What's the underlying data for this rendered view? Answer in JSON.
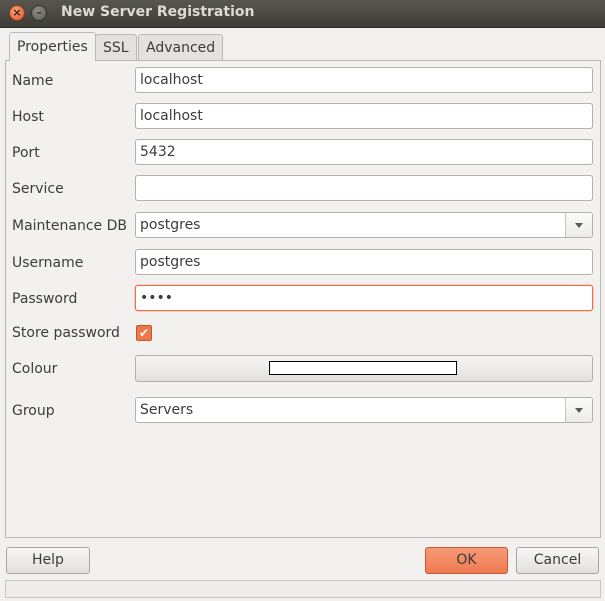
{
  "window": {
    "title": "New Server Registration",
    "close_glyph": "×",
    "minimize_glyph": "–"
  },
  "tabs": [
    {
      "label": "Properties"
    },
    {
      "label": "SSL"
    },
    {
      "label": "Advanced"
    }
  ],
  "form": {
    "name": {
      "label": "Name",
      "value": "localhost"
    },
    "host": {
      "label": "Host",
      "value": "localhost"
    },
    "port": {
      "label": "Port",
      "value": "5432"
    },
    "service": {
      "label": "Service",
      "value": ""
    },
    "maintenance_db": {
      "label": "Maintenance DB",
      "value": "postgres"
    },
    "username": {
      "label": "Username",
      "value": "postgres"
    },
    "password": {
      "label": "Password",
      "value": "••••"
    },
    "store_password": {
      "label": "Store password",
      "checked": true,
      "check_glyph": "✔"
    },
    "colour": {
      "label": "Colour",
      "swatch_color": "#ffffff"
    },
    "group": {
      "label": "Group",
      "value": "Servers"
    }
  },
  "buttons": {
    "help": "Help",
    "ok": "OK",
    "cancel": "Cancel"
  },
  "colors": {
    "accent": "#ee7a52",
    "focus_border": "#e76f4a"
  }
}
